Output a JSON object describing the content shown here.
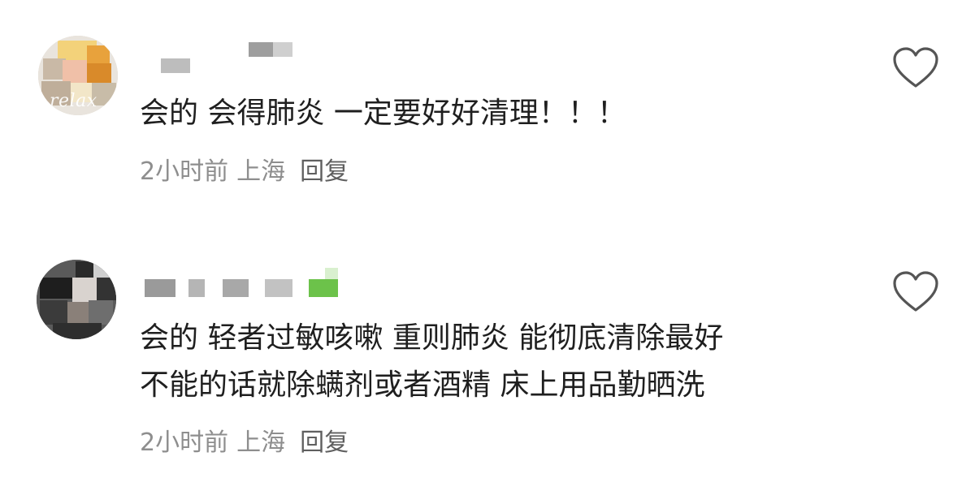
{
  "comments": [
    {
      "avatar_text": "relax",
      "body_lines": [
        "会的 会得肺炎 一定要好好清理！！！"
      ],
      "time": "2小时前",
      "location": "上海",
      "reply_label": "回复",
      "like_icon": "heart-outline-icon"
    },
    {
      "body_lines": [
        "会的 轻者过敏咳嗽 重则肺炎 能彻底清除最好",
        "不能的话就除螨剂或者酒精 床上用品勤晒洗"
      ],
      "time": "2小时前",
      "location": "上海",
      "reply_label": "回复",
      "like_icon": "heart-outline-icon"
    }
  ],
  "colors": {
    "body_text": "#1f1f1f",
    "meta_text": "#8e8e8e",
    "reply_text": "#5f5f5f",
    "icon_stroke": "#555555",
    "badge_green": "#6cc24a"
  }
}
